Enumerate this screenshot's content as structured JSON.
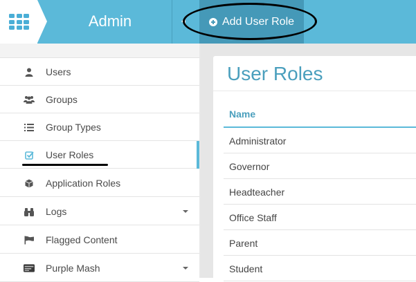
{
  "header": {
    "app_title": "Admin",
    "add_button_label": "Add User Role"
  },
  "sidebar": {
    "items": [
      {
        "label": "Users",
        "icon": "user-icon"
      },
      {
        "label": "Groups",
        "icon": "users-group-icon"
      },
      {
        "label": "Group Types",
        "icon": "list-icon"
      },
      {
        "label": "User Roles",
        "icon": "check-square-icon",
        "active": true
      },
      {
        "label": "Application Roles",
        "icon": "cube-icon"
      },
      {
        "label": "Logs",
        "icon": "binoculars-icon",
        "has_submenu": true
      },
      {
        "label": "Flagged Content",
        "icon": "flag-icon"
      },
      {
        "label": "Purple Mash",
        "icon": "purple-mash-logo-icon",
        "has_submenu": true
      }
    ]
  },
  "main": {
    "title": "User Roles",
    "table": {
      "columns": [
        "Name"
      ],
      "rows": [
        "Administrator",
        "Governor",
        "Headteacher",
        "Office Staff",
        "Parent",
        "Student"
      ]
    }
  },
  "colors": {
    "topbar": "#5bb9d9",
    "accent": "#4a9fbd",
    "button": "#4599b8"
  }
}
